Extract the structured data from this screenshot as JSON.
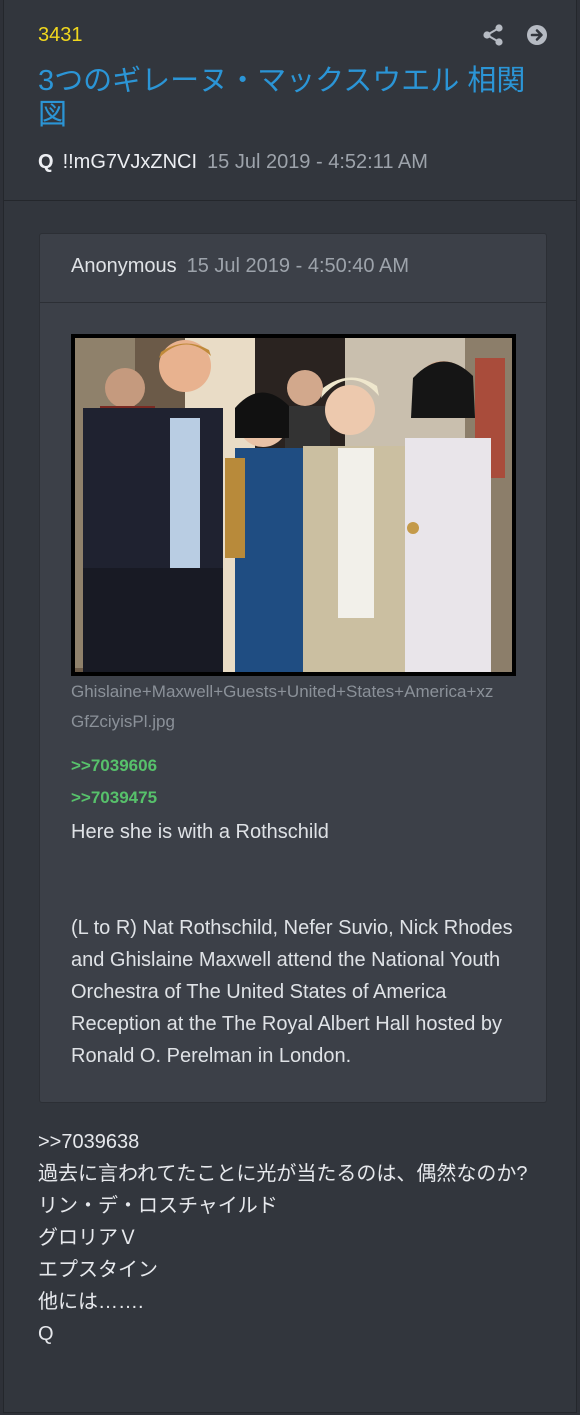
{
  "post": {
    "number": "3431",
    "title": "3つのギレーヌ・マックスウエル 相関図",
    "author": "Q",
    "tripcode": "!!mG7VJxZNCI",
    "date": "15 Jul 2019 - 4:52:11 AM",
    "share_icon": "share-icon",
    "next_icon": "arrow-circle-right-icon"
  },
  "quote": {
    "author": "Anonymous",
    "date": "15 Jul 2019 - 4:50:40 AM",
    "image": {
      "filename_line1": "Ghislaine+Maxwell+Guests+United+States+America+xz",
      "filename_line2": "GfZciyisPl.jpg"
    },
    "reply_links": [
      ">>7039606",
      ">>7039475"
    ],
    "body_line": "Here she is with a Rothschild",
    "caption": "(L to R) Nat Rothschild, Nefer Suvio, Nick Rhodes and Ghislaine Maxwell attend the National Youth Orchestra of The United States of America Reception at the The Royal Albert Hall hosted by Ronald O. Perelman in London."
  },
  "reply": {
    "ref": ">>7039638",
    "lines": [
      "過去に言われてたことに光が当たるのは、偶然なのか?",
      "リン・デ・ロスチャイルド",
      "グロリアＶ",
      "エプスタイン",
      "他には…….",
      "Q"
    ]
  },
  "colors": {
    "background": "#32363d",
    "post_number": "#f0d71e",
    "title": "#2b95d6",
    "reply_link": "#57c16b"
  }
}
